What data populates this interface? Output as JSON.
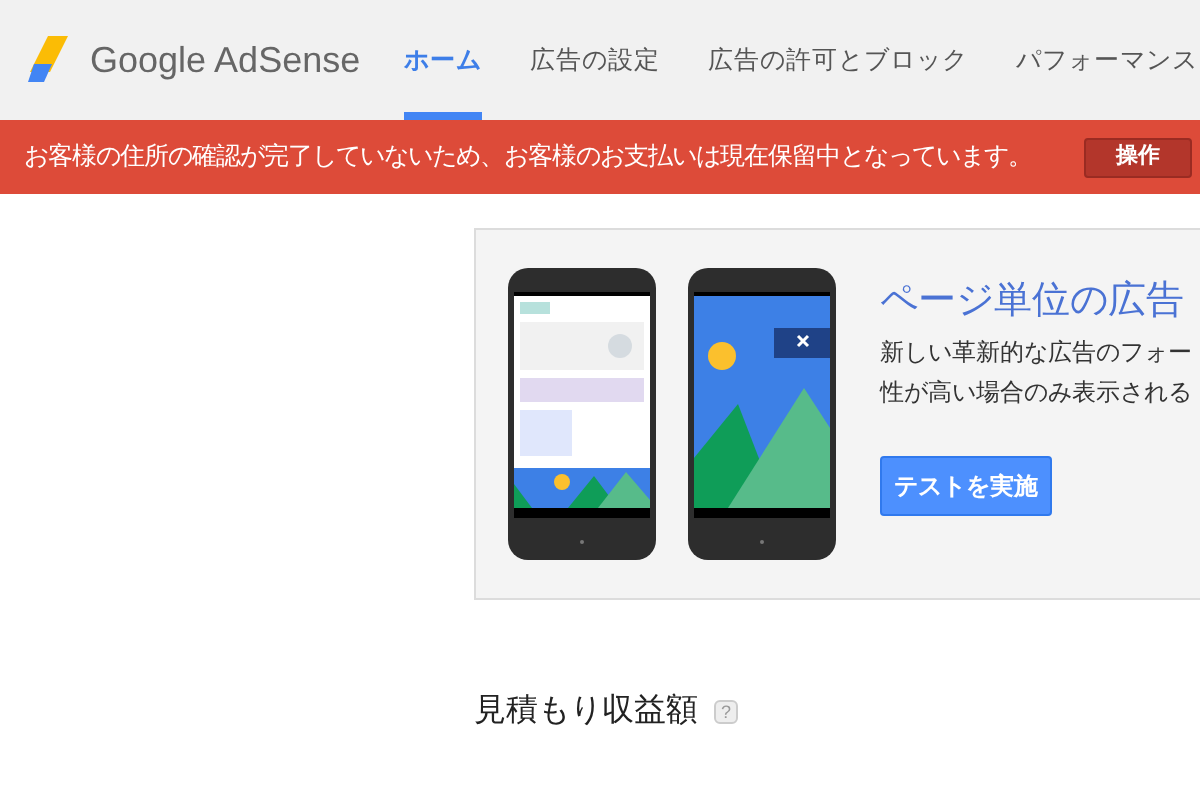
{
  "header": {
    "logo_text": "Google AdSense",
    "tabs": [
      {
        "label": "ホーム",
        "selected": true
      },
      {
        "label": "広告の設定",
        "selected": false
      },
      {
        "label": "広告の許可とブロック",
        "selected": false
      },
      {
        "label": "パフォーマンス",
        "selected": false
      }
    ]
  },
  "alert": {
    "message": "お客様の住所の確認が完了していないため、お客様のお支払いは現在保留中となっています。",
    "button": "操作"
  },
  "promo": {
    "title": "ページ単位の広告",
    "lines": [
      "新しい革新的な広告のフォー",
      "性が高い場合のみ表示される"
    ],
    "button": "テストを実施"
  },
  "section": {
    "title": "見積もり収益額",
    "help": "?"
  }
}
